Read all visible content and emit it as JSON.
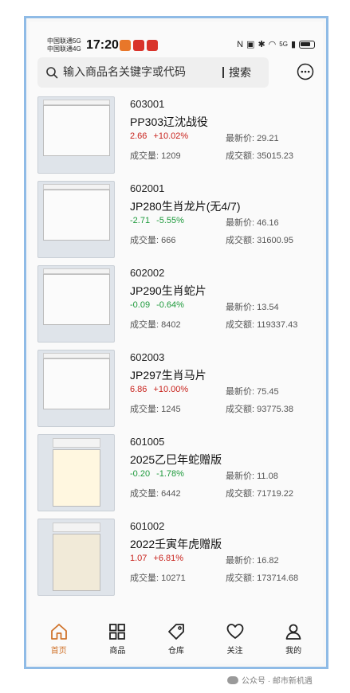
{
  "status_bar": {
    "carrier1": "中国联通5G",
    "carrier2": "中国联通4G",
    "time": "17:20",
    "signal_text": "5G"
  },
  "search": {
    "placeholder": "输入商品名关键字或代码",
    "button_label": "搜索"
  },
  "labels": {
    "last_price": "最新价:",
    "volume": "成交量:",
    "amount": "成交额:"
  },
  "items": [
    {
      "code": "603001",
      "name": "PP303辽沈战役",
      "change": "2.66",
      "change_pct": "+10.02%",
      "direction": "up",
      "last_price": "29.21",
      "volume": "1209",
      "amount": "35015.23"
    },
    {
      "code": "602001",
      "name": "JP280生肖龙片(无4/7)",
      "change": "-2.71",
      "change_pct": "-5.55%",
      "direction": "down",
      "last_price": "46.16",
      "volume": "666",
      "amount": "31600.95"
    },
    {
      "code": "602002",
      "name": "JP290生肖蛇片",
      "change": "-0.09",
      "change_pct": "-0.64%",
      "direction": "down",
      "last_price": "13.54",
      "volume": "8402",
      "amount": "119337.43"
    },
    {
      "code": "602003",
      "name": "JP297生肖马片",
      "change": "6.86",
      "change_pct": "+10.00%",
      "direction": "up",
      "last_price": "75.45",
      "volume": "1245",
      "amount": "93775.38"
    },
    {
      "code": "601005",
      "name": "2025乙巳年蛇赠版",
      "change": "-0.20",
      "change_pct": "-1.78%",
      "direction": "down",
      "last_price": "11.08",
      "volume": "6442",
      "amount": "71719.22"
    },
    {
      "code": "601002",
      "name": "2022壬寅年虎赠版",
      "change": "1.07",
      "change_pct": "+6.81%",
      "direction": "up",
      "last_price": "16.82",
      "volume": "10271",
      "amount": "173714.68"
    }
  ],
  "nav": [
    {
      "label": "首页",
      "icon": "home-icon",
      "active": true
    },
    {
      "label": "商品",
      "icon": "grid-icon",
      "active": false
    },
    {
      "label": "仓库",
      "icon": "tag-icon",
      "active": false
    },
    {
      "label": "关注",
      "icon": "heart-icon",
      "active": false
    },
    {
      "label": "我的",
      "icon": "user-icon",
      "active": false
    }
  ],
  "watermark": "公众号 · 邮市新机遇",
  "colors": {
    "up": "#c8221c",
    "down": "#1e9a3c",
    "active_nav": "#d0732b",
    "frame": "#8fbbe6"
  }
}
